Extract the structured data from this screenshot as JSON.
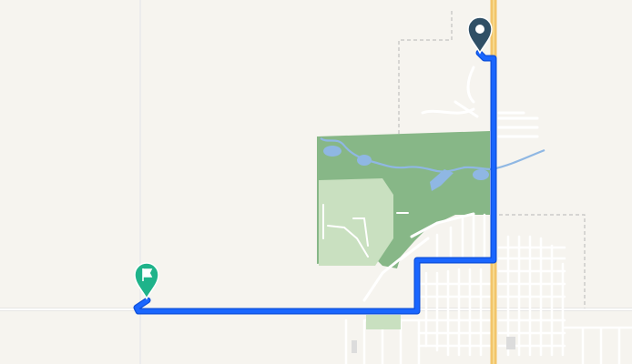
{
  "map": {
    "colors": {
      "background": "#f6f4ef",
      "park": "#87b787",
      "golf": "#c9e0c0",
      "water": "#8fb7e3",
      "road": "#ffffff",
      "highway": "#f2c56a",
      "route": "#1a66ff",
      "start_marker": "#2f4f66",
      "end_marker": "#1fb38a"
    },
    "markers": [
      {
        "name": "start-marker",
        "icon": "location-pin-icon"
      },
      {
        "name": "end-marker",
        "icon": "finish-flag-icon"
      }
    ]
  }
}
